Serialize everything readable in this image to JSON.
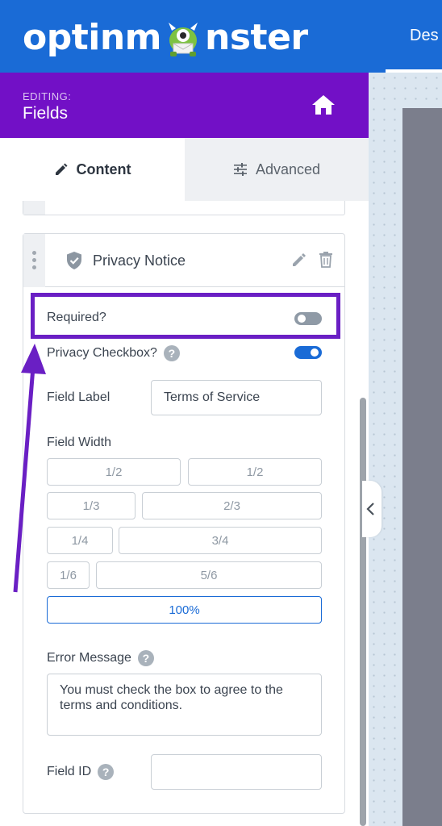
{
  "topbar": {
    "logo_left": "optinm",
    "logo_right": "nster",
    "tab_partial": "Des"
  },
  "editing": {
    "label": "EDITING:",
    "title": "Fields"
  },
  "tabs": [
    {
      "label": "Content",
      "icon": "pencil-icon",
      "active": true
    },
    {
      "label": "Advanced",
      "icon": "sliders-icon",
      "active": false
    }
  ],
  "field": {
    "title": "Privacy Notice",
    "required_label": "Required?",
    "required_on": false,
    "privacy_checkbox_label": "Privacy Checkbox?",
    "privacy_checkbox_on": true,
    "field_label_label": "Field Label",
    "field_label_value": "Terms of Service",
    "field_width_label": "Field Width",
    "width_options": [
      "1/2",
      "1/2",
      "1/3",
      "2/3",
      "1/4",
      "3/4",
      "1/6",
      "5/6",
      "100%"
    ],
    "width_selected": "100%",
    "error_message_label": "Error Message",
    "error_message_value": "You must check the box to agree to the terms and conditions.",
    "field_id_label": "Field ID",
    "field_id_value": ""
  },
  "colors": {
    "topbar": "#1a6bd6",
    "editbar": "#7210c6",
    "annotation": "#6a1fc4",
    "toggle_on": "#1a6bd6"
  },
  "help_glyph": "?"
}
